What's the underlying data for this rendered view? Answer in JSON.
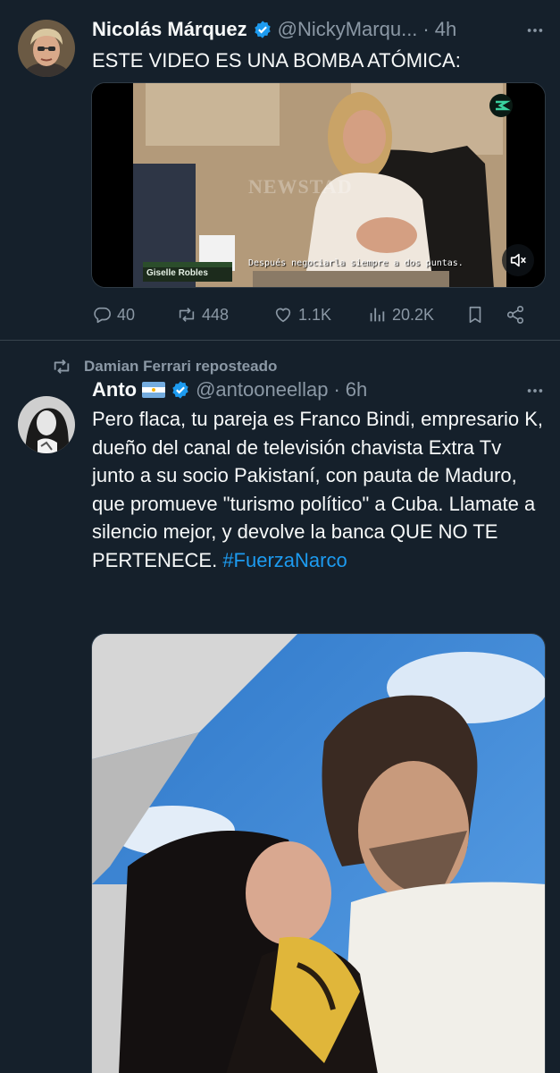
{
  "tweets": [
    {
      "author_name": "Nicolás Márquez",
      "handle": "@NickyMarqu...",
      "separator": "·",
      "time": "4h",
      "text": "ESTE VIDEO ES UNA BOMBA ATÓMICA:",
      "media": {
        "type": "video",
        "subtitle": "Después negociarla siempre a dos puntas.",
        "lower_third_name": "Giselle Robles",
        "watermark": "NEWSTAD"
      },
      "stats": {
        "replies": "40",
        "reposts": "448",
        "likes": "1.1K",
        "views": "20.2K"
      }
    },
    {
      "repost_label": "Damian Ferrari reposteado",
      "author_name": "Anto",
      "handle": "@antooneellap",
      "separator": "·",
      "time": "6h",
      "text": "Pero flaca, tu pareja es Franco Bindi, empresario K, dueño del canal de televisión chavista Extra Tv junto a su socio Pakistaní, con pauta de Maduro, que promueve \"turismo político\" a Cuba. Llamate a silencio mejor, y devolve la banca QUE NO TE PERTENECE.",
      "hashtag": "#FuerzaNarco",
      "media": {
        "type": "photo"
      }
    }
  ],
  "icons": {
    "verified": "verified-badge-icon",
    "more": "more-icon",
    "reply": "reply-icon",
    "repost": "repost-icon",
    "like": "like-icon",
    "views": "views-icon",
    "bookmark": "bookmark-icon",
    "share": "share-icon",
    "flag": "argentina-flag-icon",
    "mute": "volume-muted-icon"
  },
  "colors": {
    "background": "#15202b",
    "text": "#f7f9f9",
    "secondary": "#8b98a5",
    "accent": "#1d9bf0",
    "divider": "#38444d"
  }
}
